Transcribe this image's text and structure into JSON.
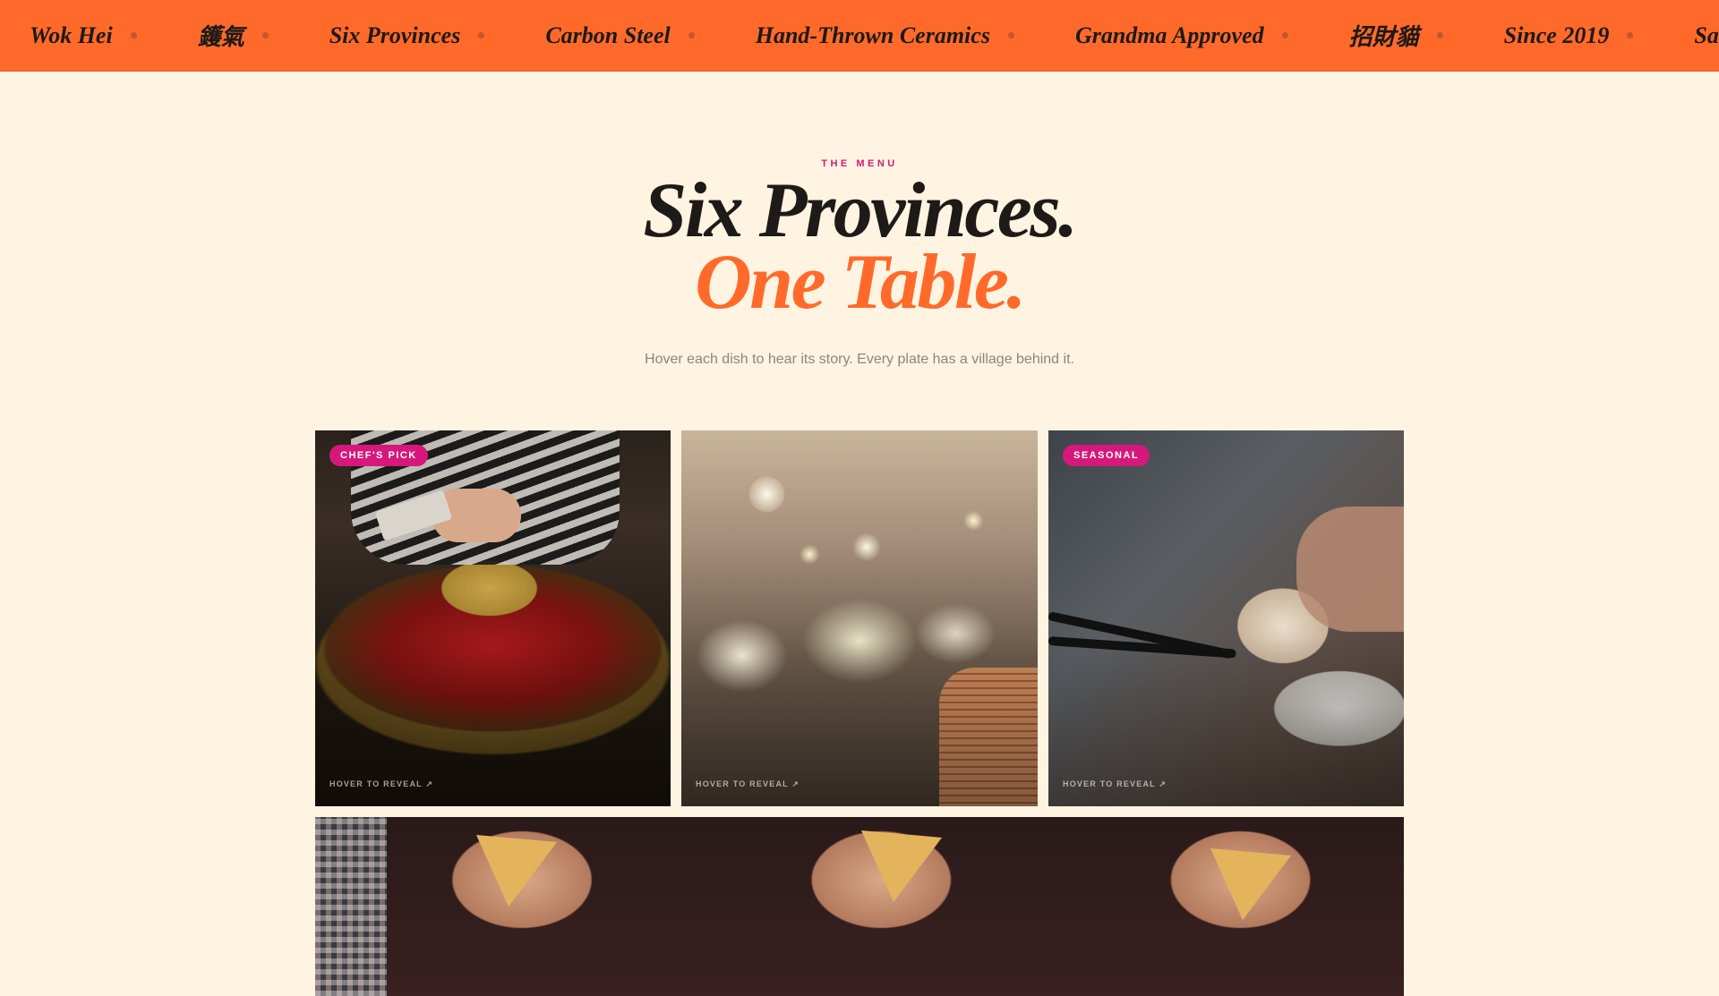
{
  "ticker": {
    "items": [
      "Wok Hei",
      "鑊氣",
      "Six Provinces",
      "Carbon Steel",
      "Hand-Thrown Ceramics",
      "Grandma Approved",
      "招財貓",
      "Since 2019",
      "Same Table"
    ]
  },
  "section": {
    "eyebrow": "THE MENU",
    "title_line1": "Six Provinces.",
    "title_line2": "One Table.",
    "subtitle": "Hover each dish to hear its story. Every plate has a village behind it."
  },
  "cards": [
    {
      "badge": "CHEF'S PICK",
      "hint": "HOVER TO REVEAL ↗",
      "image": "hotpot-photo"
    },
    {
      "badge": "",
      "hint": "HOVER TO REVEAL ↗",
      "image": "dim-sum-photo"
    },
    {
      "badge": "SEASONAL",
      "hint": "HOVER TO REVEAL ↗",
      "image": "soup-dumpling-photo"
    },
    {
      "badge": "",
      "hint": "",
      "image": "pizza-table-photo"
    }
  ],
  "colors": {
    "accent": "#ff6a2b",
    "badge": "#d6187c",
    "background": "#fff4e1",
    "text": "#1d1a17"
  }
}
